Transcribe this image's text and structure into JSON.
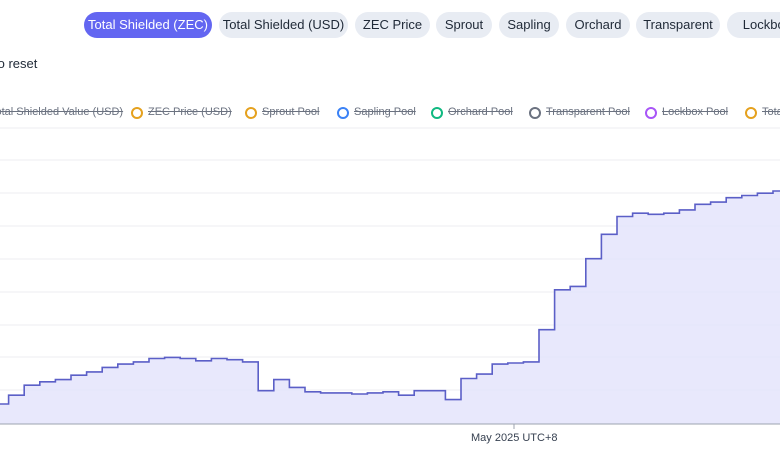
{
  "tabs": [
    {
      "label": "Total Shielded (ZEC)",
      "active": true
    },
    {
      "label": "Total Shielded (USD)",
      "active": false
    },
    {
      "label": "ZEC Price",
      "active": false
    },
    {
      "label": "Sprout",
      "active": false
    },
    {
      "label": "Sapling",
      "active": false
    },
    {
      "label": "Orchard",
      "active": false
    },
    {
      "label": "Transparent",
      "active": false
    },
    {
      "label": "Lockbox",
      "active": false
    }
  ],
  "hint": "to reset",
  "legend": [
    {
      "label": "Total Shielded Value (USD)",
      "color": "#e5a11e"
    },
    {
      "label": "ZEC Price (USD)",
      "color": "#e5a11e"
    },
    {
      "label": "Sprout Pool",
      "color": "#e5a11e"
    },
    {
      "label": "Sapling Pool",
      "color": "#3b82f6"
    },
    {
      "label": "Orchard Pool",
      "color": "#10b981"
    },
    {
      "label": "Transparent Pool",
      "color": "#6b7280"
    },
    {
      "label": "Lockbox Pool",
      "color": "#a855f7"
    },
    {
      "label": "Tota",
      "color": "#e5a11e"
    }
  ],
  "colors": {
    "accent": "#6366f1",
    "line": "#5b5fc7",
    "fill": "#e4e4fb"
  },
  "chart_data": {
    "type": "area",
    "series": [
      {
        "values": [
          18,
          26,
          35,
          38,
          40,
          44,
          47,
          51,
          54,
          56,
          59,
          60,
          59,
          57,
          59,
          58,
          56,
          30,
          40,
          33,
          29,
          28,
          28,
          27,
          28,
          29,
          26,
          30,
          30,
          22,
          41,
          45,
          54,
          55,
          56,
          85,
          121,
          124,
          149,
          171,
          187,
          190,
          189,
          190,
          193,
          198,
          200,
          204,
          206,
          208,
          210
        ]
      }
    ],
    "xtick_label": "May 2025 UTC+8",
    "grid": true
  }
}
